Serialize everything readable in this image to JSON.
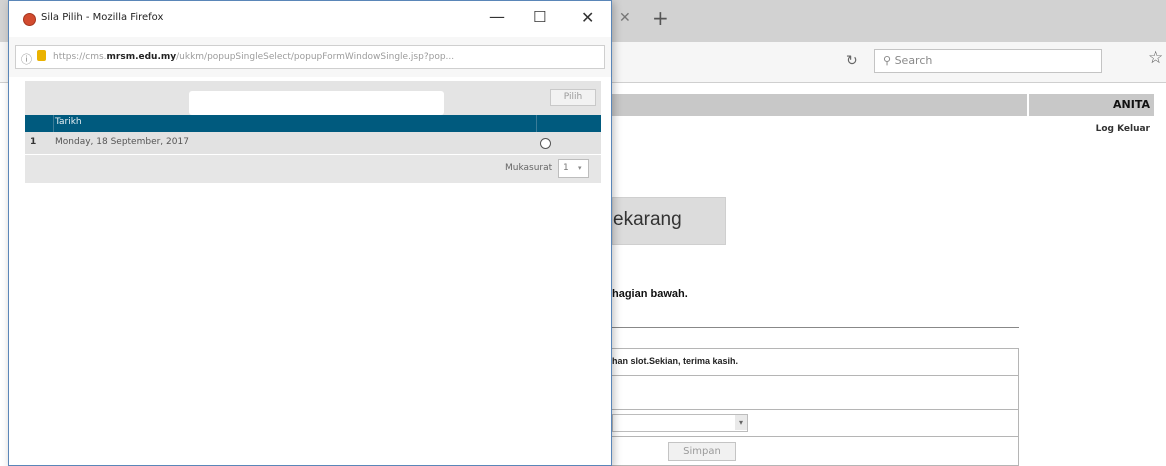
{
  "background_browser": {
    "search_placeholder": "Search",
    "header_user": "ANITA",
    "logout_label": "Log Keluar",
    "big_button_label": "ekarang",
    "instruction_text": "hagian bawah.",
    "notice_text": "han slot.Sekian, terima kasih.",
    "save_label": "Simpan"
  },
  "popup": {
    "title": "Sila Pilih - Mozilla Firefox",
    "url_prefix": "https://cms.",
    "url_domain": "mrsm.edu.my",
    "url_suffix": "/ukkm/popupSingleSelect/popupFormWindowSingle.jsp?pop...",
    "pilih_label": "Pilih",
    "table": {
      "columns": [
        "Tarikh"
      ],
      "rows": [
        {
          "num": "1",
          "date": "Monday, 18 September, 2017"
        }
      ]
    },
    "pager_label": "Mukasurat",
    "pager_value": "1"
  },
  "icons": {
    "close": "close-icon",
    "new_tab": "plus-icon",
    "reload": "reload-icon",
    "search": "search-icon",
    "star": "star-icon",
    "minimize": "minimize-icon",
    "maximize": "maximize-icon",
    "info": "info-icon",
    "lock": "lock-icon",
    "chevron": "chevron-down-icon"
  },
  "colors": {
    "table_header": "#005a7e",
    "popup_border": "#5a86b8"
  }
}
